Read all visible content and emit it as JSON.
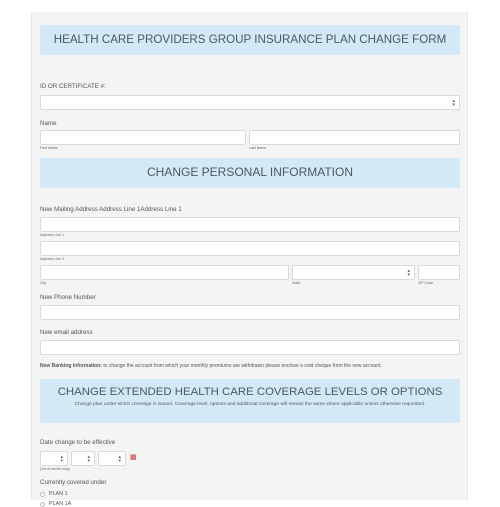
{
  "form": {
    "title": "HEALTH CARE PROVIDERS GROUP INSURANCE PLAN CHANGE FORM",
    "id_label": "ID OR CERTIFICATE #:",
    "name_label": "Name",
    "first_name_label": "First Name",
    "last_name_label": "Last Name"
  },
  "personal": {
    "heading": "CHANGE PERSONAL INFORMATION",
    "address_label": "New Mailing Address Address Line 1Address Line 1",
    "address_line1_label": "Address Line 1",
    "address_line2_label": "Address Line 2",
    "city_label": "City",
    "state_label": "State",
    "zip_label": "ZIP Code",
    "phone_label": "New Phone Number",
    "email_label": "New email address",
    "banking_bold": "New Banking Information:",
    "banking_text": " to change the account from which your monthly premiums are withdrawn please enclose a void cheque from the new account."
  },
  "coverage": {
    "heading": "CHANGE EXTENDED HEALTH CARE COVERAGE LEVELS OR OPTIONS",
    "subtext": "Change plan under which coverage is issued. Coverage level, options and additional coverage will remain the same where applicable unless otherwise requested.",
    "date_label": "Date change to be effective",
    "date_hint": "(1st of month only)",
    "covered_label": "Currently covered under",
    "plans": [
      "PLAN 1",
      "PLAN 1A"
    ]
  },
  "icons": {
    "select_arrows": "up-down-arrows",
    "calendar": "calendar-icon"
  }
}
